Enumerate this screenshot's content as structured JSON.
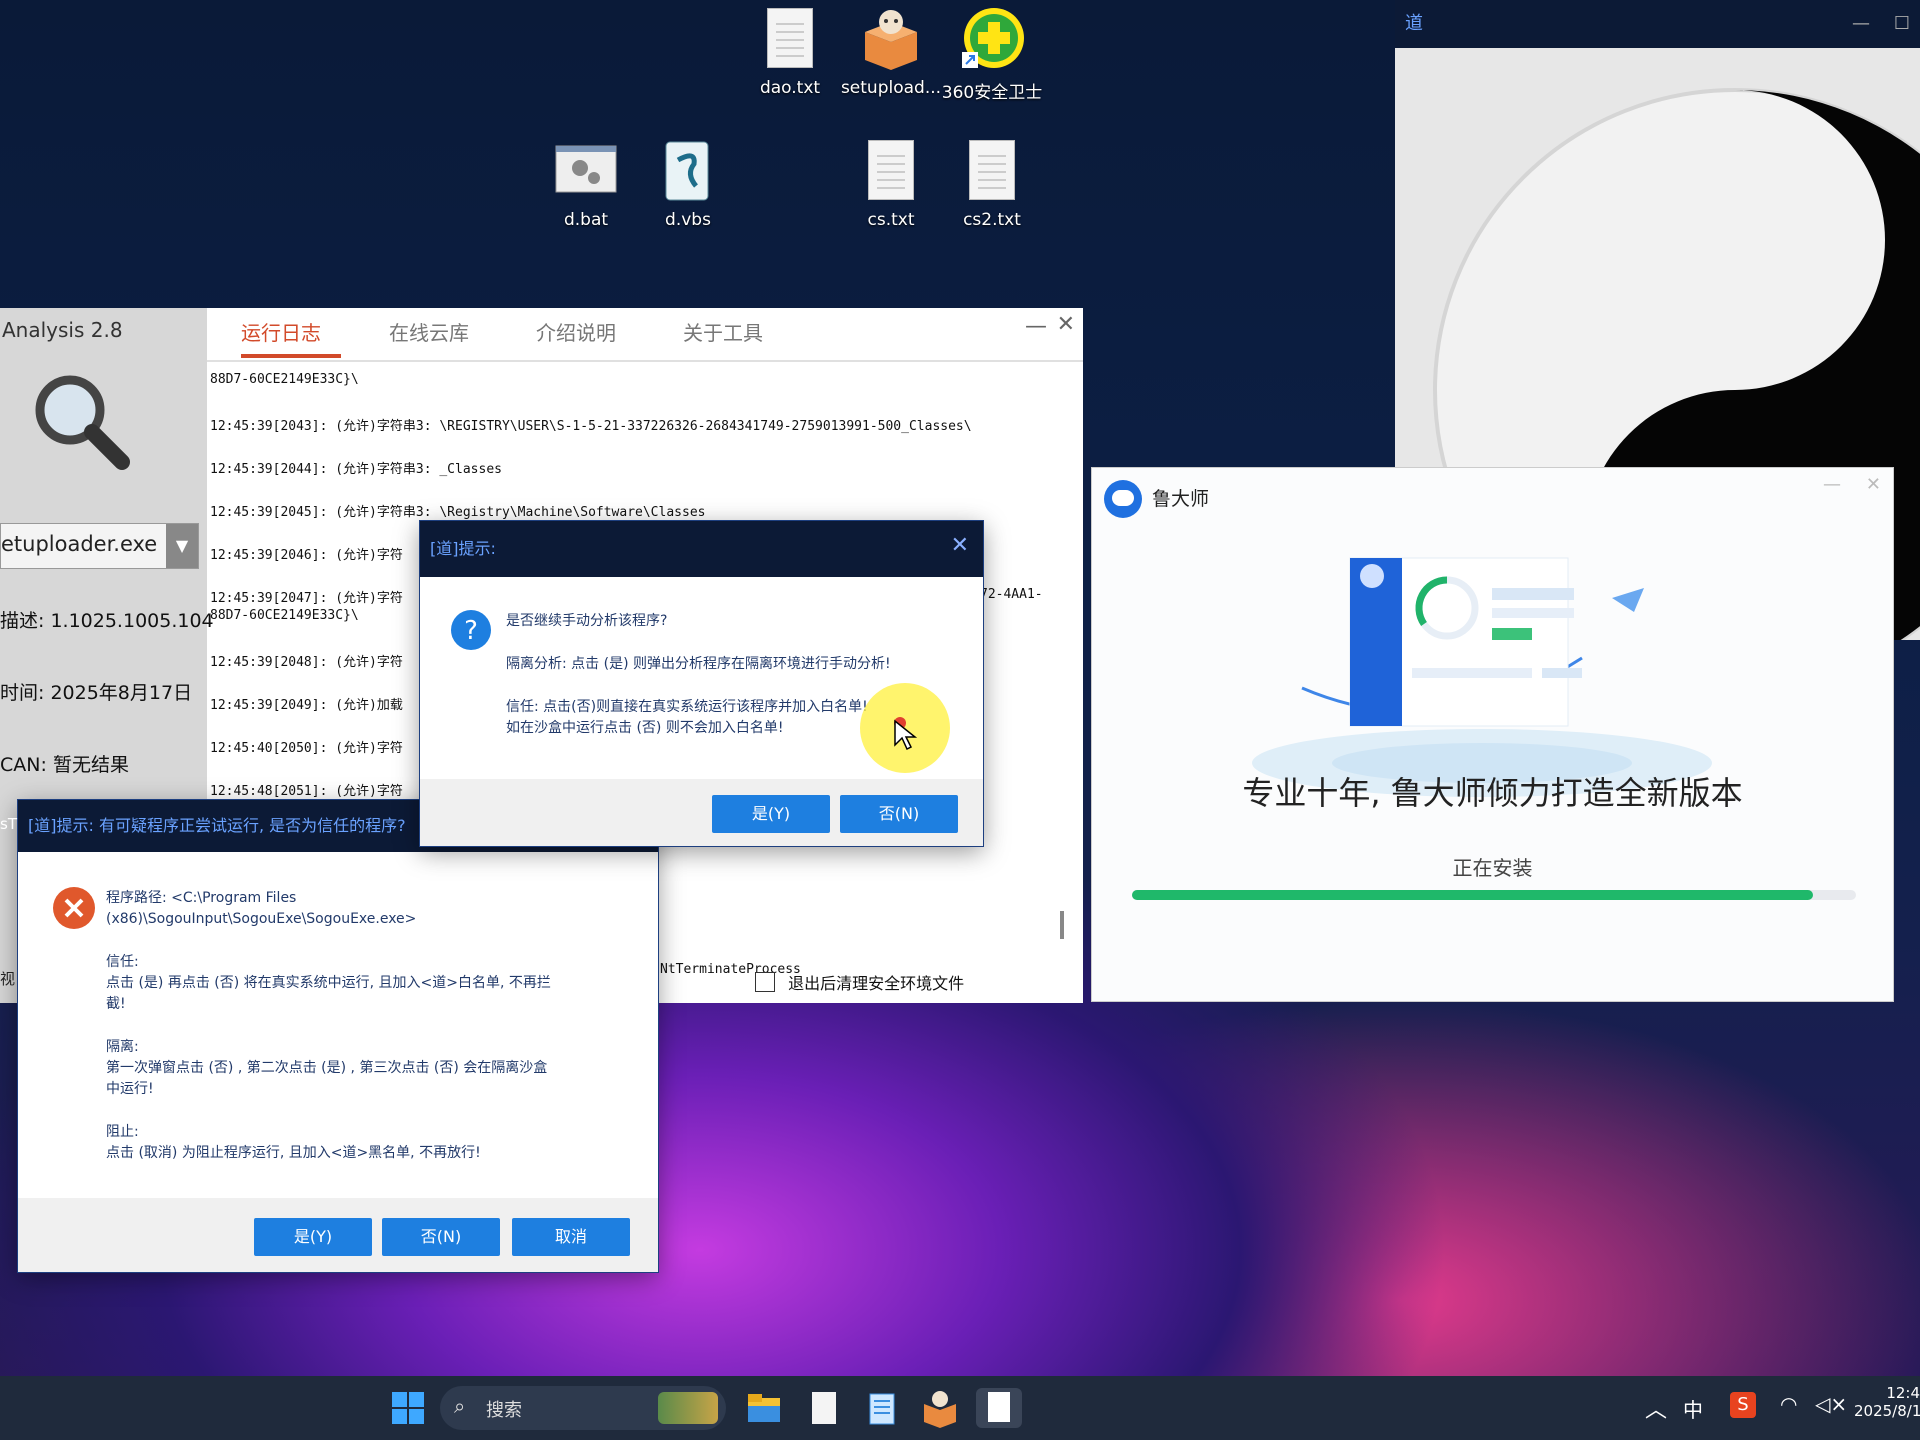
{
  "desktop": {
    "icons": [
      {
        "name": "dao.txt"
      },
      {
        "name": "setupload..."
      },
      {
        "name": "360安全卫士"
      },
      {
        "name": "d.bat"
      },
      {
        "name": "d.vbs"
      },
      {
        "name": "cs.txt"
      },
      {
        "name": "cs2.txt"
      }
    ]
  },
  "dao_window": {
    "title": "道"
  },
  "analysis_window": {
    "title": "Analysis 2.8",
    "process": "etuploader.exe",
    "desc_label": "描述:",
    "desc_value": "1.1025.1005.104",
    "time_label": "时间:",
    "time_value": "2025年8月17日",
    "scan_label": "CAN:",
    "scan_value": "暂无结果",
    "tabs": [
      "运行日志",
      "在线云库",
      "介绍说明",
      "关于工具"
    ],
    "log_lines": [
      "88D7-60CE2149E33C}\\",
      "12:45:39[2043]: (允许)字符串3: \\REGISTRY\\USER\\S-1-5-21-337226326-2684341749-2759013991-500_Classes\\",
      "12:45:39[2044]: (允许)字符串3: _Classes",
      "12:45:39[2045]: (允许)字符串3: \\Registry\\Machine\\Software\\Classes",
      "12:45:39[2046]: (允许)字符",
      "12:45:39[2047]: (允许)字符",
      "88D7-60CE2149E33C}\\",
      "12:45:39[2048]: (允许)字符",
      "12:45:39[2049]: (允许)加载",
      "12:45:40[2050]: (允许)字符",
      "12:45:48[2051]: (允许)字符"
    ],
    "log_tail_right": "72-4AA1-",
    "log_ntterminate": "NtTerminateProcess",
    "checkbox_label": "退出后清理安全环境文件"
  },
  "dialog_top": {
    "title": "[道]提示:",
    "question": "是否继续手动分析该程序?",
    "line1": "隔离分析: 点击 (是) 则弹出分析程序在隔离环境进行手动分析!",
    "line2": "信任: 点击(否)则直接在真实系统运行该程序并加入白名单!",
    "line3": "如在沙盒中运行点击 (否) 则不会加入白名单!",
    "yes": "是(Y)",
    "no": "否(N)"
  },
  "dialog_bottom": {
    "title": "[道]提示: 有可疑程序正尝试运行, 是否为信任的程序?",
    "path_label": "程序路径:",
    "path_value": "<C:\\Program Files",
    "path_value2": "(x86)\\SogouInput\\SogouExe\\SogouExe.exe>",
    "trust_label": "信任:",
    "trust_text1": "点击 (是) 再点击 (否) 将在真实系统中运行, 且加入<道>白名单, 不再拦",
    "trust_text2": "截!",
    "isolate_label": "隔离:",
    "isolate_text1": "第一次弹窗点击 (否) , 第二次点击 (是) , 第三次点击 (否) 会在隔离沙盒",
    "isolate_text2": "中运行!",
    "block_label": "阻止:",
    "block_text": "点击 (取消) 为阻止程序运行, 且加入<道>黑名单, 不再放行!",
    "yes": "是(Y)",
    "no": "否(N)",
    "cancel": "取消",
    "side_label": "sT",
    "side_label2": "视"
  },
  "ludashi": {
    "title": "鲁大师",
    "headline": "专业十年, 鲁大师倾力打造全新版本",
    "status": "正在安装",
    "progress": 0.94
  },
  "taskbar": {
    "search": "搜索",
    "tray_lang": "中",
    "time": "12:4",
    "date": "2025/8/1"
  },
  "colors": {
    "accent": "#1e7fe0",
    "tab_active": "#d24a2a",
    "progress": "#1fb86a",
    "dialog_title_bg": "#0c1a36"
  }
}
